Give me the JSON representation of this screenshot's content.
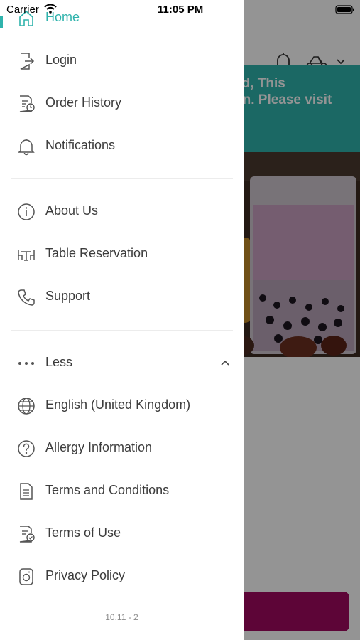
{
  "status_bar": {
    "carrier": "Carrier",
    "time": "11:05 PM"
  },
  "background": {
    "banner_lines": [
      "ed, This",
      "on. Please visit",
      "."
    ],
    "banner_color": "#2fb3ac",
    "cta_color": "#a00a5f"
  },
  "menu": {
    "home": "Home",
    "primary_items": [
      {
        "label": "Login",
        "icon": "login-icon"
      },
      {
        "label": "Order History",
        "icon": "order-history-icon"
      },
      {
        "label": "Notifications",
        "icon": "bell-icon"
      }
    ],
    "secondary_items": [
      {
        "label": "About Us",
        "icon": "info-icon"
      },
      {
        "label": "Table Reservation",
        "icon": "table-icon"
      },
      {
        "label": "Support",
        "icon": "phone-icon"
      }
    ],
    "less_label": "Less",
    "more_items": [
      {
        "label": "English (United Kingdom)",
        "icon": "globe-icon"
      },
      {
        "label": "Allergy Information",
        "icon": "question-icon"
      },
      {
        "label": "Terms and Conditions",
        "icon": "document-icon"
      },
      {
        "label": "Terms of Use",
        "icon": "document-check-icon"
      },
      {
        "label": "Privacy Policy",
        "icon": "privacy-icon"
      }
    ]
  },
  "version": "10.11 - 2",
  "accent_color": "#2fb3ac"
}
